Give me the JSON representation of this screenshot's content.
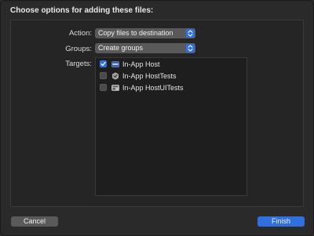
{
  "dialog": {
    "title": "Choose options for adding these files:"
  },
  "form": {
    "action_label": "Action:",
    "action_value": "Copy files to destination",
    "groups_label": "Groups:",
    "groups_value": "Create groups",
    "targets_label": "Targets:"
  },
  "targets": [
    {
      "label": "In-App Host",
      "checked": true,
      "icon": "app-target-icon"
    },
    {
      "label": "In-App HostTests",
      "checked": false,
      "icon": "unit-test-bundle-icon"
    },
    {
      "label": "In-App HostUITests",
      "checked": false,
      "icon": "ui-test-bundle-icon"
    }
  ],
  "buttons": {
    "cancel": "Cancel",
    "finish": "Finish"
  },
  "colors": {
    "accent": "#2f6fe0",
    "background": "#2a2a2a",
    "list_background": "#1e1e1e"
  }
}
